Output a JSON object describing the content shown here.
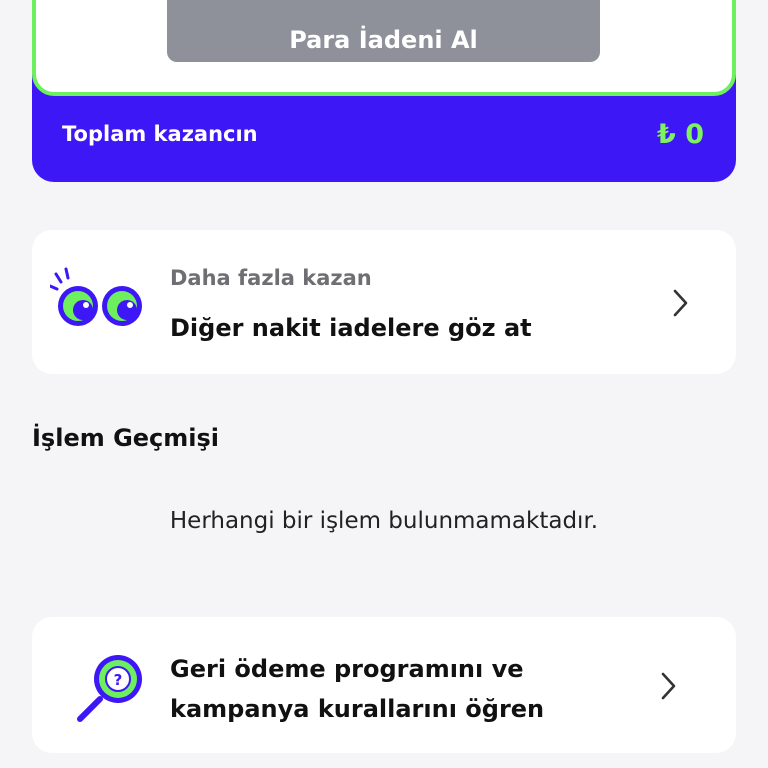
{
  "cashback": {
    "claim_button_label": "Para İadeni Al",
    "total_label": "Toplam kazancın",
    "total_value": "₺ 0"
  },
  "more_card": {
    "icon": "eyes-icon",
    "subtitle": "Daha fazla kazan",
    "title": "Diğer nakit iadelere göz at"
  },
  "history": {
    "heading": "İşlem Geçmişi",
    "empty_message": "Herhangi bir işlem bulunmamaktadır."
  },
  "rules_card": {
    "icon": "magnifier-question-icon",
    "title_line1": "Geri ödeme programını ve",
    "title_line2": "kampanya kurallarını öğren"
  },
  "colors": {
    "brand_purple": "#3d17f5",
    "accent_green": "#6ef05e",
    "disabled_gray": "#8e9199"
  }
}
